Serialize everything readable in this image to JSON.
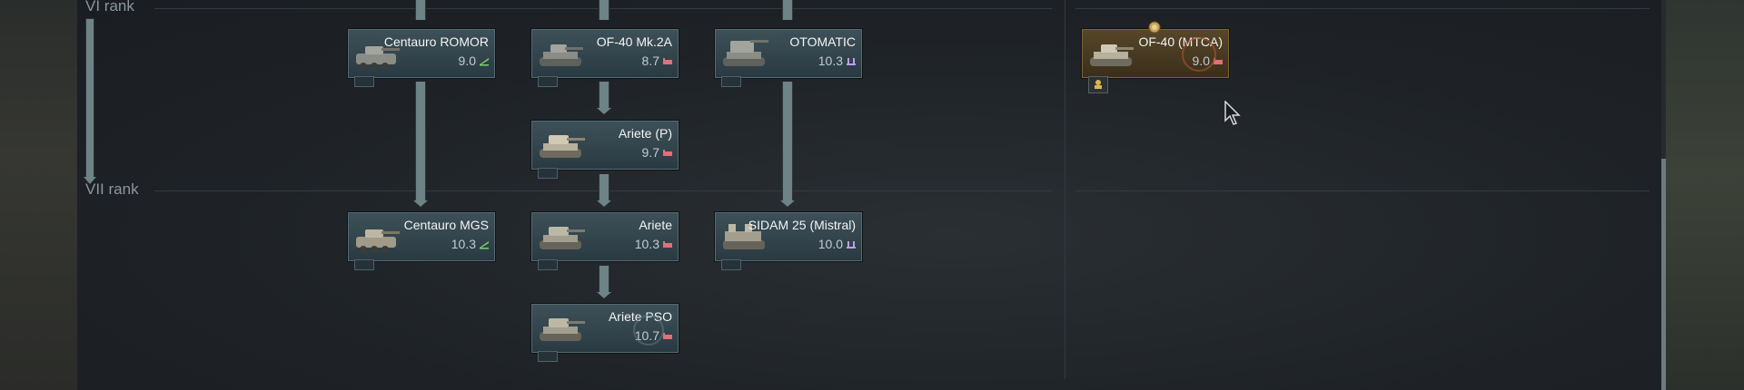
{
  "ranks": [
    {
      "label": "VI rank"
    },
    {
      "label": "VII rank"
    }
  ],
  "vehicles": [
    {
      "name": "Centauro ROMOR",
      "br": "9.0",
      "role": "tank-destroyer-icon",
      "role_color": "#7fcf73"
    },
    {
      "name": "OF-40 Mk.2A",
      "br": "8.7",
      "role": "medium-tank-icon",
      "role_color": "#e0707a"
    },
    {
      "name": "OTOMATIC",
      "br": "10.3",
      "role": "spaa-icon",
      "role_color": "#b9a0e8"
    },
    {
      "name": "OF-40 (MTCA)",
      "br": "9.0",
      "role": "medium-tank-icon",
      "role_color": "#e0707a"
    },
    {
      "name": "Ariete (P)",
      "br": "9.7",
      "role": "medium-tank-icon",
      "role_color": "#e0707a"
    },
    {
      "name": "Centauro MGS",
      "br": "10.3",
      "role": "tank-destroyer-icon",
      "role_color": "#7fcf73"
    },
    {
      "name": "Ariete",
      "br": "10.3",
      "role": "medium-tank-icon",
      "role_color": "#e0707a"
    },
    {
      "name": "SIDAM 25 (Mistral)",
      "br": "10.0",
      "role": "spaa-icon",
      "role_color": "#b9a0e8"
    },
    {
      "name": "Ariete PSO",
      "br": "10.7",
      "role": "medium-tank-icon",
      "role_color": "#e0707a"
    }
  ],
  "colors": {
    "connector": "#6d8386",
    "card": "#2f4149",
    "premium_card": "#4a3b22"
  }
}
